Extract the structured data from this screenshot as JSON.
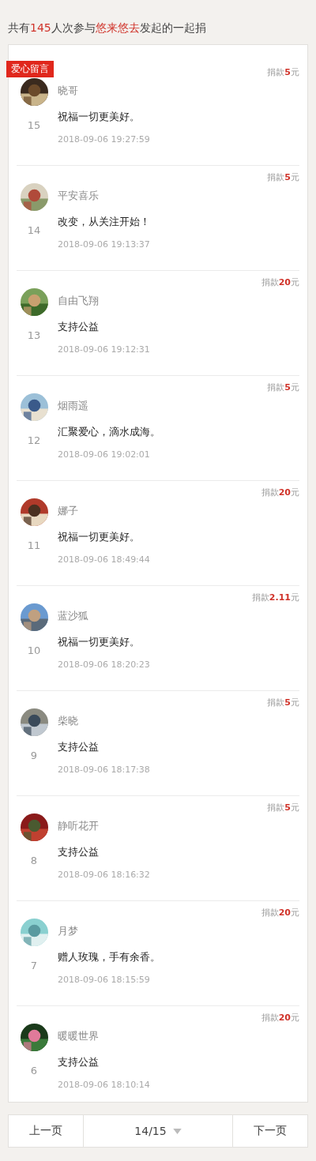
{
  "summary": [
    {
      "text": "共有",
      "highlight": false
    },
    {
      "text": "145",
      "highlight": true
    },
    {
      "text": "人次参与",
      "highlight": false
    },
    {
      "text": "悠来悠去",
      "highlight": true
    },
    {
      "text": "发起的一起捐",
      "highlight": false
    }
  ],
  "tag": "爱心留言",
  "entries": [
    {
      "name": "晓哥",
      "number": "15",
      "message": "祝福一切更美好。",
      "time": "2018-09-06 19:27:59",
      "prefix": "捐款",
      "amount": "5",
      "unit": "元"
    },
    {
      "name": "平安喜乐",
      "number": "14",
      "message": "改变，从关注开始！",
      "time": "2018-09-06 19:13:37",
      "prefix": "捐款",
      "amount": "5",
      "unit": "元"
    },
    {
      "name": "自由飞翔",
      "number": "13",
      "message": "支持公益",
      "time": "2018-09-06 19:12:31",
      "prefix": "捐款",
      "amount": "20",
      "unit": "元"
    },
    {
      "name": "烟雨遥",
      "number": "12",
      "message": "汇聚爱心，滴水成海。",
      "time": "2018-09-06 19:02:01",
      "prefix": "捐款",
      "amount": "5",
      "unit": "元"
    },
    {
      "name": "娜子",
      "number": "11",
      "message": "祝福一切更美好。",
      "time": "2018-09-06 18:49:44",
      "prefix": "捐款",
      "amount": "20",
      "unit": "元"
    },
    {
      "name": "蓝沙狐",
      "number": "10",
      "message": "祝福一切更美好。",
      "time": "2018-09-06 18:20:23",
      "prefix": "捐款",
      "amount": "2.11",
      "unit": "元"
    },
    {
      "name": "柴晓",
      "number": "9",
      "message": "支持公益",
      "time": "2018-09-06 18:17:38",
      "prefix": "捐款",
      "amount": "5",
      "unit": "元"
    },
    {
      "name": "静听花开",
      "number": "8",
      "message": "支持公益",
      "time": "2018-09-06 18:16:32",
      "prefix": "捐款",
      "amount": "5",
      "unit": "元"
    },
    {
      "name": "月梦",
      "number": "7",
      "message": "赠人玫瑰，手有余香。",
      "time": "2018-09-06 18:15:59",
      "prefix": "捐款",
      "amount": "20",
      "unit": "元"
    },
    {
      "name": "暖暖世界",
      "number": "6",
      "message": "支持公益",
      "time": "2018-09-06 18:10:14",
      "prefix": "捐款",
      "amount": "20",
      "unit": "元"
    }
  ],
  "pagination": {
    "previous": "上一页",
    "page": "14/15",
    "next": "下一页"
  }
}
